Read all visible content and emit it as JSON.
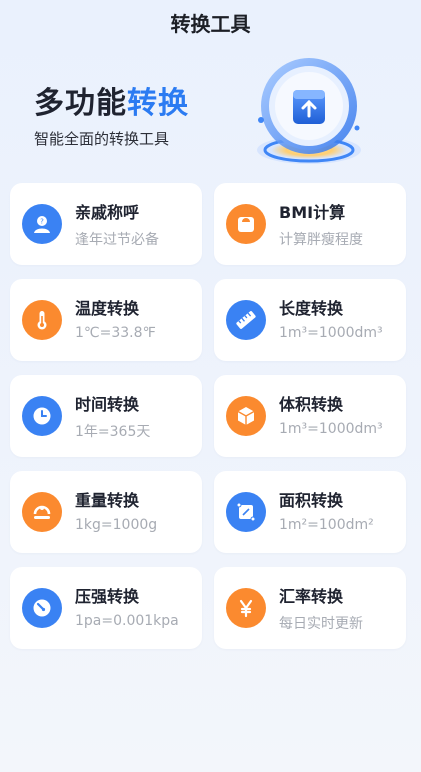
{
  "header": {
    "title": "转换工具"
  },
  "banner": {
    "title_prefix": "多功能",
    "title_highlight": "转换",
    "subtitle": "智能全面的转换工具"
  },
  "tools": [
    {
      "title": "亲戚称呼",
      "subtitle": "逢年过节必备",
      "icon": "relative-icon",
      "color": "#3a82f3"
    },
    {
      "title": "BMI计算",
      "subtitle": "计算胖瘦程度",
      "icon": "scale-icon",
      "color": "#fb8a2f"
    },
    {
      "title": "温度转换",
      "subtitle": "1℃=33.8℉",
      "icon": "thermometer-icon",
      "color": "#fb8a2f"
    },
    {
      "title": "长度转换",
      "subtitle": "1m³=1000dm³",
      "icon": "ruler-icon",
      "color": "#3a82f3"
    },
    {
      "title": "时间转换",
      "subtitle": "1年=365天",
      "icon": "clock-icon",
      "color": "#3a82f3"
    },
    {
      "title": "体积转换",
      "subtitle": "1m³=1000dm³",
      "icon": "cube-icon",
      "color": "#fb8a2f"
    },
    {
      "title": "重量转换",
      "subtitle": "1kg=1000g",
      "icon": "weight-icon",
      "color": "#fb8a2f"
    },
    {
      "title": "面积转换",
      "subtitle": "1m²=100dm²",
      "icon": "area-icon",
      "color": "#3a82f3"
    },
    {
      "title": "压强转换",
      "subtitle": "1pa=0.001kpa",
      "icon": "gauge-icon",
      "color": "#3a82f3"
    },
    {
      "title": "汇率转换",
      "subtitle": "每日实时更新",
      "icon": "yen-icon",
      "color": "#fb8a2f"
    }
  ]
}
